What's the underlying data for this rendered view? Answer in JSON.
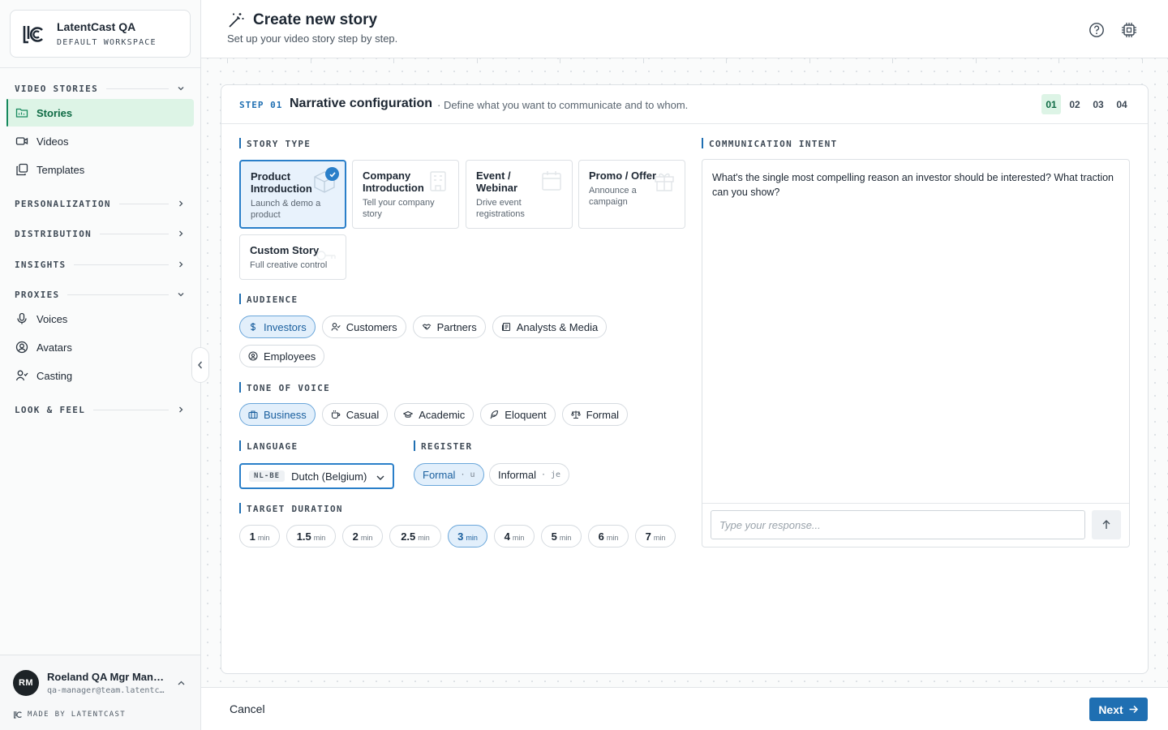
{
  "workspace": {
    "name": "LatentCast QA",
    "subtitle": "DEFAULT WORKSPACE"
  },
  "sidebar": {
    "sections": [
      {
        "label": "VIDEO STORIES",
        "expanded": true
      },
      {
        "label": "PERSONALIZATION",
        "expanded": false
      },
      {
        "label": "DISTRIBUTION",
        "expanded": false
      },
      {
        "label": "INSIGHTS",
        "expanded": false
      },
      {
        "label": "PROXIES",
        "expanded": true
      },
      {
        "label": "LOOK & FEEL",
        "expanded": false
      }
    ],
    "items": [
      {
        "label": "Stories",
        "icon": "folder-icon",
        "active": true
      },
      {
        "label": "Videos",
        "icon": "video-icon"
      },
      {
        "label": "Templates",
        "icon": "templates-icon"
      },
      {
        "label": "Voices",
        "icon": "mic-icon"
      },
      {
        "label": "Avatars",
        "icon": "user-circle-icon"
      },
      {
        "label": "Casting",
        "icon": "casting-icon"
      }
    ],
    "user": {
      "initials": "RM",
      "name": "Roeland QA Mgr Manager",
      "email": "qa-manager@team.latentcast.com"
    },
    "made_by": "MADE BY LATENTCAST"
  },
  "header": {
    "title": "Create new story",
    "subtitle": "Set up your video story step by step."
  },
  "step": {
    "kicker": "STEP 01",
    "title": "Narrative configuration",
    "description": "· Define what you want to communicate and to whom.",
    "numbers": [
      "01",
      "02",
      "03",
      "04"
    ],
    "current": "01"
  },
  "story_type": {
    "label": "STORY TYPE",
    "options": [
      {
        "title": "Product Introduction",
        "desc": "Launch & demo a product",
        "selected": true
      },
      {
        "title": "Company Introduction",
        "desc": "Tell your company story"
      },
      {
        "title": "Event / Webinar",
        "desc": "Drive event registrations"
      },
      {
        "title": "Promo / Offer",
        "desc": "Announce a campaign"
      },
      {
        "title": "Custom Story",
        "desc": "Full creative control"
      }
    ]
  },
  "audience": {
    "label": "AUDIENCE",
    "options": [
      {
        "label": "Investors",
        "icon": "dollar-icon",
        "selected": true
      },
      {
        "label": "Customers",
        "icon": "user-check-icon"
      },
      {
        "label": "Partners",
        "icon": "handshake-icon"
      },
      {
        "label": "Analysts & Media",
        "icon": "newspaper-icon"
      },
      {
        "label": "Employees",
        "icon": "badge-icon"
      }
    ]
  },
  "tone": {
    "label": "TONE OF VOICE",
    "options": [
      {
        "label": "Business",
        "icon": "briefcase-icon",
        "selected": true
      },
      {
        "label": "Casual",
        "icon": "coffee-icon"
      },
      {
        "label": "Academic",
        "icon": "graduation-cap-icon"
      },
      {
        "label": "Eloquent",
        "icon": "feather-icon"
      },
      {
        "label": "Formal",
        "icon": "scale-icon"
      }
    ]
  },
  "language": {
    "label": "LANGUAGE",
    "code": "NL-BE",
    "value": "Dutch (Belgium)"
  },
  "register": {
    "label": "REGISTER",
    "options": [
      {
        "label": "Formal",
        "sub": "u",
        "selected": true
      },
      {
        "label": "Informal",
        "sub": "je"
      }
    ],
    "separator": "·"
  },
  "duration": {
    "label": "TARGET DURATION",
    "unit": "min",
    "options": [
      "1",
      "1.5",
      "2",
      "2.5",
      "3",
      "4",
      "5",
      "6",
      "7"
    ],
    "selected": "3"
  },
  "intent": {
    "label": "COMMUNICATION INTENT",
    "question": "What's the single most compelling reason an investor should be interested? What traction can you show?",
    "placeholder": "Type your response..."
  },
  "footer": {
    "cancel": "Cancel",
    "next": "Next"
  },
  "colors": {
    "accent": "#1f6fb2",
    "brand_green": "#16895d",
    "active_bg": "#ddf4e6"
  }
}
